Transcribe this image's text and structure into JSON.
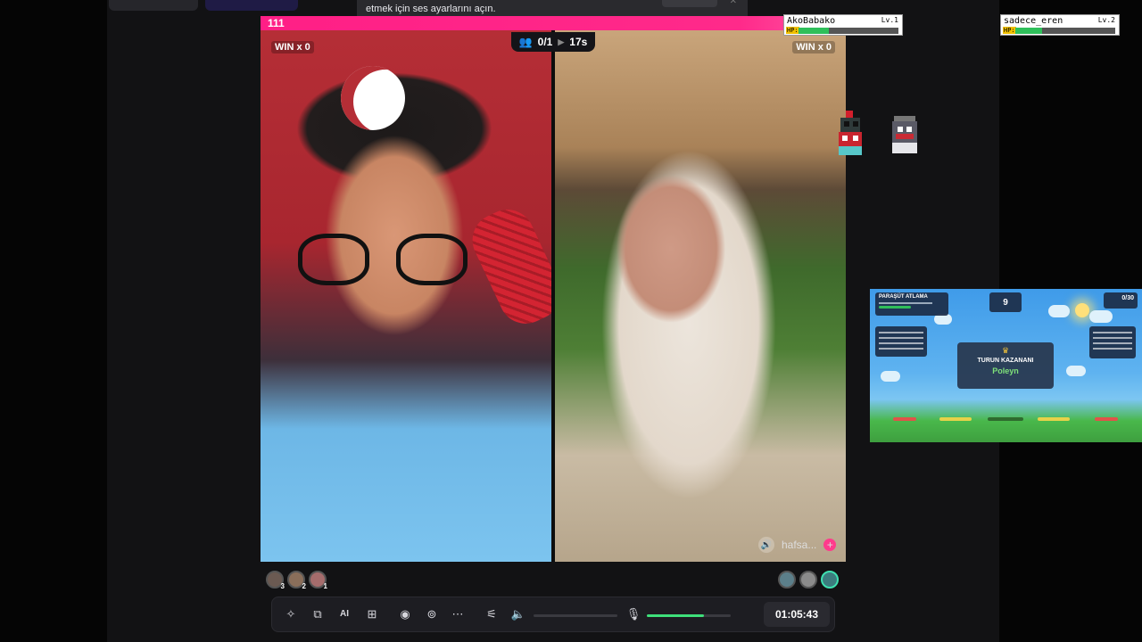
{
  "notification": {
    "text": "etmek için ses ayarlarını açın."
  },
  "pk": {
    "score": "111",
    "left_win": "WIN x 0",
    "right_win": "WIN x 0",
    "viewers": "0/1",
    "timer": "17s",
    "right_name": "hafsa..."
  },
  "hp_overlays": [
    {
      "name": "AkoBabako",
      "level": "Lv.1",
      "hp_label": "HP:",
      "hp_fraction": 0.3
    },
    {
      "name": "sadece_eren",
      "level": "Lv.2",
      "hp_label": "HP:",
      "hp_fraction": 0.27
    }
  ],
  "left_ranks": [
    "3",
    "2",
    "1"
  ],
  "controls": {
    "session_time": "01:05:43",
    "mic_volume": 0.68,
    "icons": [
      "magic-wand-icon",
      "layers-icon",
      "ai-icon",
      "add-source-icon",
      "record-icon",
      "live-icon",
      "more-icon",
      "settings-sliders-icon",
      "speaker-icon",
      "microphone-icon"
    ]
  },
  "game": {
    "title": "PARAŞÜT ATLAMA",
    "count_center": "9",
    "count_right": "0/30",
    "winner_heading": "TURUN KAZANANI",
    "winner_name": "Poleyn"
  },
  "colors": {
    "accent_pink": "#ff2a8a",
    "hp_green": "#2fbf5a",
    "volume_green": "#3ee07a"
  }
}
